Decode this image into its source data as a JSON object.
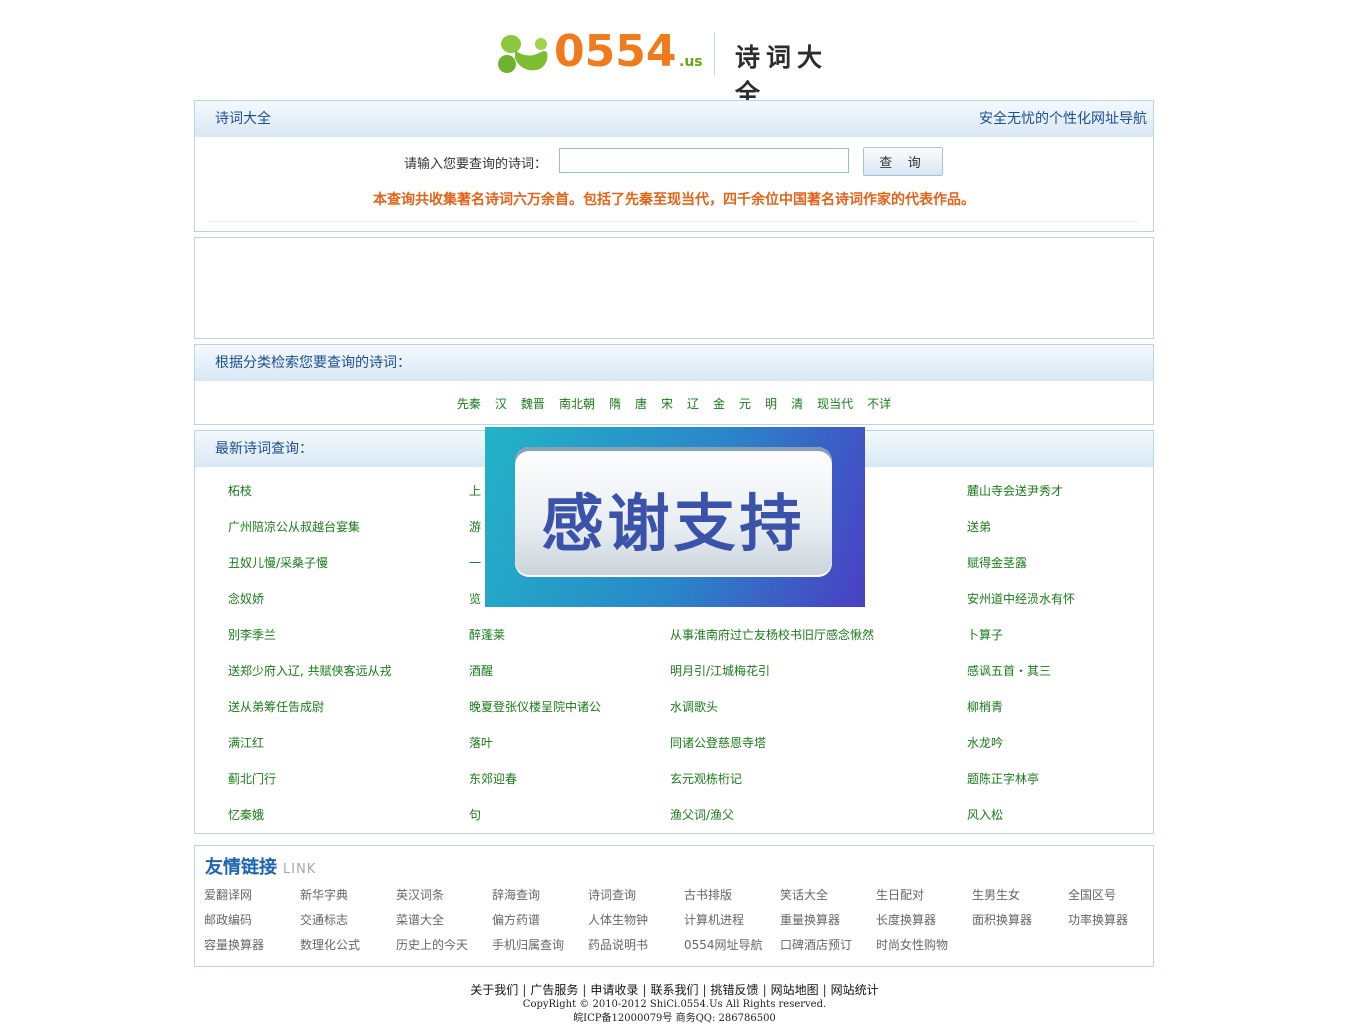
{
  "brand": {
    "digits": "0554",
    "suffix": ".us",
    "site_title": "诗词大全"
  },
  "header_panel": {
    "title": "诗词大全",
    "right_link": "安全无忧的个性化网址导航",
    "search_label": "请输入您要查询的诗词：",
    "search_value": "",
    "search_button": "查 询",
    "notice": "本查询共收集著名诗词六万余首。包括了先秦至现当代，四千余位中国著名诗词作家的代表作品。"
  },
  "categories": {
    "title": "根据分类检索您要查询的诗词：",
    "items": [
      "先秦",
      "汉",
      "魏晋",
      "南北朝",
      "隋",
      "唐",
      "宋",
      "辽",
      "金",
      "元",
      "明",
      "清",
      "现当代",
      "不详"
    ]
  },
  "latest": {
    "title": "最新诗词查询：",
    "rows": [
      [
        "柘枝",
        "上",
        "",
        "麓山寺会送尹秀才"
      ],
      [
        "广州陪凉公从叔越台宴集",
        "游",
        "",
        "送弟"
      ],
      [
        "丑奴儿慢/采桑子慢",
        "一",
        "",
        "赋得金茎露"
      ],
      [
        "念奴娇",
        "览",
        "",
        "安州道中经涢水有怀"
      ],
      [
        "别李季兰",
        "醉蓬莱",
        "从事淮南府过亡友杨校书旧厅感念愀然",
        "卜算子"
      ],
      [
        "送郑少府入辽, 共赋侠客远从戎",
        "酒醒",
        "明月引/江城梅花引",
        "感讽五首・其三"
      ],
      [
        "送从弟筹任告成尉",
        "晚夏登张仪楼呈院中诸公",
        "水调歌头",
        "柳梢青"
      ],
      [
        "满江红",
        "落叶",
        "同诸公登慈恩寺塔",
        "水龙吟"
      ],
      [
        "蓟北门行",
        "东郊迎春",
        "玄元观栋桁记",
        "题陈正字林亭"
      ],
      [
        "忆秦娥",
        "句",
        "渔父词/渔父",
        "风入松"
      ]
    ]
  },
  "popup": {
    "text": "感谢支持"
  },
  "links": {
    "title": "友情链接",
    "title_en": "LINK",
    "rows": [
      [
        "爱翻译网",
        "新华字典",
        "英汉词条",
        "辞海查询",
        "诗词查询",
        "古书排版",
        "笑话大全",
        "生日配对",
        "生男生女",
        "全国区号"
      ],
      [
        "邮政编码",
        "交通标志",
        "菜谱大全",
        "偏方药谱",
        "人体生物钟",
        "计算机进程",
        "重量换算器",
        "长度换算器",
        "面积换算器",
        "功率换算器"
      ],
      [
        "容量换算器",
        "数理化公式",
        "历史上的今天",
        "手机归属查询",
        "药品说明书",
        "0554网址导航",
        "口碑酒店预订",
        "时尚女性购物"
      ]
    ]
  },
  "footer": {
    "nav": [
      "关于我们",
      "广告服务",
      "申请收录",
      "联系我们",
      "挑错反馈",
      "网站地图",
      "网站统计"
    ],
    "separator": "|",
    "copyright": "CopyRight © 2010-2012 ShiCi.0554.Us All Rights reserved.",
    "icp": "皖ICP备12000079号 商务QQ: 286786500"
  },
  "colors": {
    "accent_blue": "#1d4f8e",
    "link_green": "#1a7a1a",
    "notice_orange": "#e0641a",
    "brand_orange": "#f07a1c"
  }
}
